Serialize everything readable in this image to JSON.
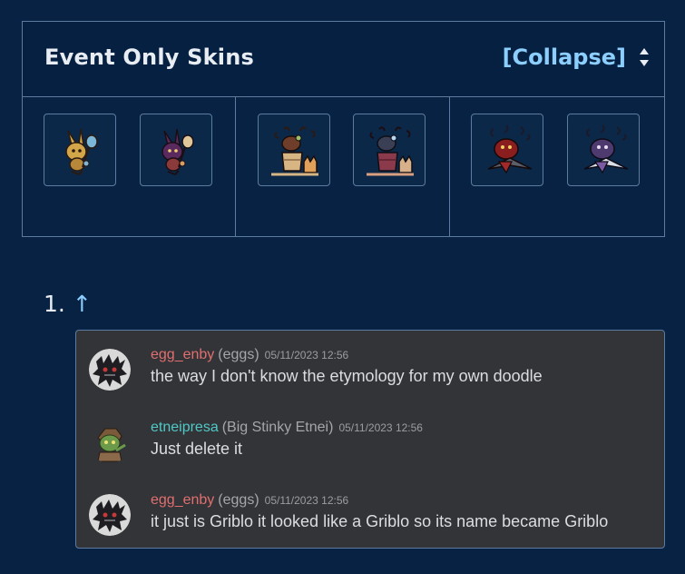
{
  "skins_section": {
    "title": "Event Only Skins",
    "collapse_label": "[Collapse]",
    "sort_icon": "sort-up-down-icon",
    "skins": [
      {
        "icon": "bunny-pet-skin-tan-icon"
      },
      {
        "icon": "bunny-pet-skin-purple-icon"
      },
      {
        "icon": "basket-pet-skin-tan-icon"
      },
      {
        "icon": "basket-pet-skin-purple-icon"
      },
      {
        "icon": "bird-pet-skin-red-icon"
      },
      {
        "icon": "bird-pet-skin-violet-icon"
      }
    ]
  },
  "reference": {
    "number": "1.",
    "arrow": "↑"
  },
  "chat": {
    "messages": [
      {
        "username": "egg_enby",
        "nickname": "(eggs)",
        "timestamp": "05/11/2023 12:56",
        "text": "the way I don't know the etymology for my own doodle",
        "avatar_icon": "black-creature-avatar-icon"
      },
      {
        "username": "etneipresa",
        "nickname": "(Big Stinky Etnei)",
        "timestamp": "05/11/2023 12:56",
        "text": "Just delete it",
        "avatar_icon": "goblin-avatar-icon"
      },
      {
        "username": "egg_enby",
        "nickname": "(eggs)",
        "timestamp": "05/11/2023 12:56",
        "text": "it just is Griblo it looked like a Griblo so its name became Griblo",
        "avatar_icon": "black-creature-avatar-icon"
      }
    ]
  },
  "colors": {
    "page_bg": "#082244",
    "border": "#5d7aa0",
    "link": "#8ccfff",
    "chat_bg": "#333438",
    "username_red": "#e06f6f",
    "username_teal": "#4fc9c6"
  }
}
